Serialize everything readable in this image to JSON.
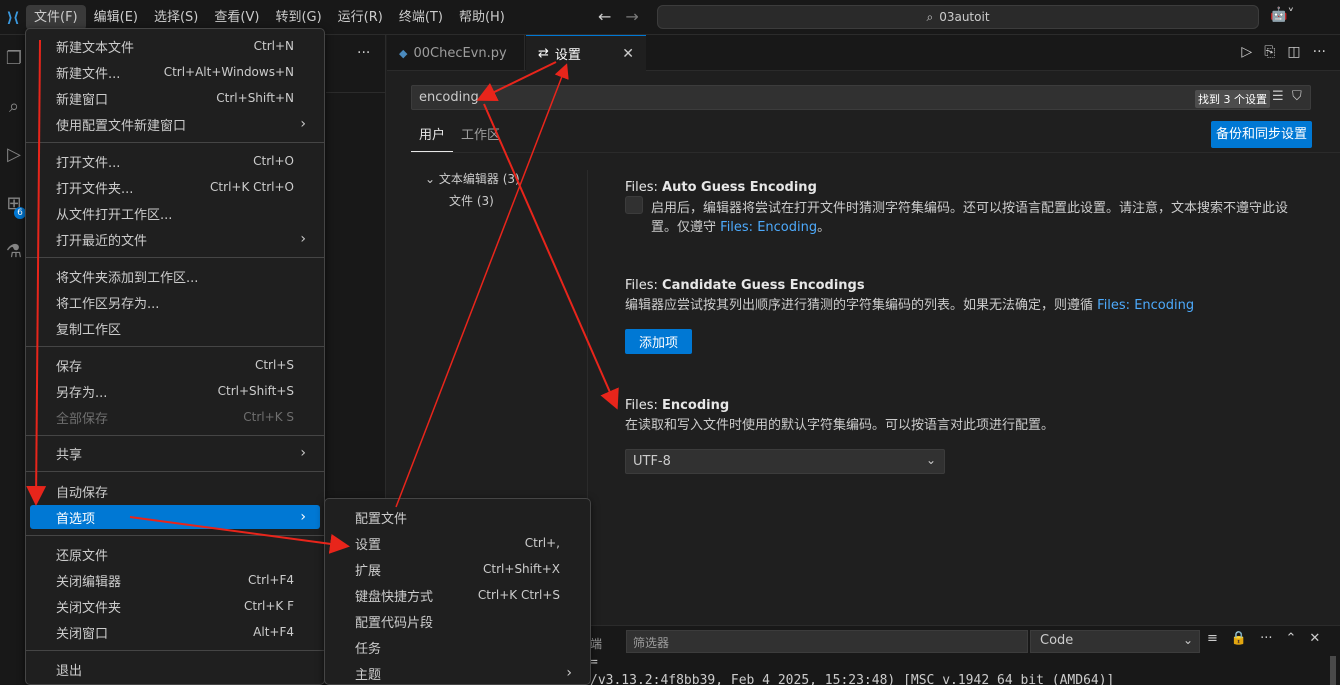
{
  "titlebar": {
    "menus": [
      "文件(F)",
      "编辑(E)",
      "选择(S)",
      "查看(V)",
      "转到(G)",
      "运行(R)",
      "终端(T)",
      "帮助(H)"
    ],
    "search_text": "03autoit"
  },
  "tabs": [
    {
      "label": "00ChecEvn.py"
    },
    {
      "label": "设置"
    }
  ],
  "settings": {
    "search_value": "encoding",
    "result_count": "找到 3 个设置",
    "scope_tabs": [
      "用户",
      "工作区"
    ],
    "sync_button": "备份和同步设置",
    "toc": {
      "group": "文本编辑器",
      "group_count": "(3)",
      "child": "文件",
      "child_count": "(3)"
    },
    "items": [
      {
        "prefix": "Files: ",
        "name": "Auto Guess Encoding",
        "desc": "启用后，编辑器将尝试在打开文件时猜测字符集编码。还可以按语言配置此设置。请注意，文本搜索不遵守此设置。仅遵守",
        "link": "Files: Encoding",
        "suffix": "。"
      },
      {
        "prefix": "Files: ",
        "name": "Candidate Guess Encodings",
        "desc": "编辑器应尝试按其列出顺序进行猜测的字符集编码的列表。如果无法确定，则遵循",
        "link": "Files: Encoding",
        "button": "添加项"
      },
      {
        "prefix": "Files: ",
        "name": "Encoding",
        "desc": "在读取和写入文件时使用的默认字符集编码。可以按语言对此项进行配置。",
        "select_value": "UTF-8"
      }
    ]
  },
  "file_menu": [
    {
      "label": "新建文本文件",
      "kb": "Ctrl+N"
    },
    {
      "label": "新建文件...",
      "kb": "Ctrl+Alt+Windows+N"
    },
    {
      "label": "新建窗口",
      "kb": "Ctrl+Shift+N"
    },
    {
      "label": "使用配置文件新建窗口",
      "kb": "",
      "submenu": true
    },
    {
      "label": "打开文件...",
      "kb": "Ctrl+O"
    },
    {
      "label": "打开文件夹...",
      "kb": "Ctrl+K Ctrl+O"
    },
    {
      "label": "从文件打开工作区...",
      "kb": ""
    },
    {
      "label": "打开最近的文件",
      "kb": "",
      "submenu": true
    },
    {
      "label": "将文件夹添加到工作区...",
      "kb": ""
    },
    {
      "label": "将工作区另存为...",
      "kb": ""
    },
    {
      "label": "复制工作区",
      "kb": ""
    },
    {
      "label": "保存",
      "kb": "Ctrl+S"
    },
    {
      "label": "另存为...",
      "kb": "Ctrl+Shift+S"
    },
    {
      "label": "全部保存",
      "kb": "Ctrl+K S",
      "disabled": true
    },
    {
      "label": "共享",
      "kb": "",
      "submenu": true
    },
    {
      "label": "自动保存",
      "kb": ""
    },
    {
      "label": "首选项",
      "kb": "",
      "submenu": true,
      "active": true
    },
    {
      "label": "还原文件",
      "kb": ""
    },
    {
      "label": "关闭编辑器",
      "kb": "Ctrl+F4"
    },
    {
      "label": "关闭文件夹",
      "kb": "Ctrl+K F"
    },
    {
      "label": "关闭窗口",
      "kb": "Alt+F4"
    },
    {
      "label": "退出",
      "kb": ""
    }
  ],
  "pref_menu": [
    {
      "label": "配置文件",
      "kb": ""
    },
    {
      "label": "设置",
      "kb": "Ctrl+,"
    },
    {
      "label": "扩展",
      "kb": "Ctrl+Shift+X"
    },
    {
      "label": "键盘快捷方式",
      "kb": "Ctrl+K Ctrl+S"
    },
    {
      "label": "配置代码片段",
      "kb": ""
    },
    {
      "label": "任务",
      "kb": ""
    },
    {
      "label": "主题",
      "kb": "",
      "submenu": true
    }
  ],
  "panel": {
    "tab_partial": "端",
    "filter_placeholder": "筛选器",
    "channel": "Code",
    "output_line1": "=",
    "output_line2": "/v3.13.2:4f8bb39, Feb  4 2025, 15:23:48) [MSC v.1942 64 bit (AMD64)]"
  },
  "activity_badge": "6",
  "colors": {
    "accent": "#0078d4",
    "link": "#4daafc",
    "annotation": "#e8251b"
  }
}
